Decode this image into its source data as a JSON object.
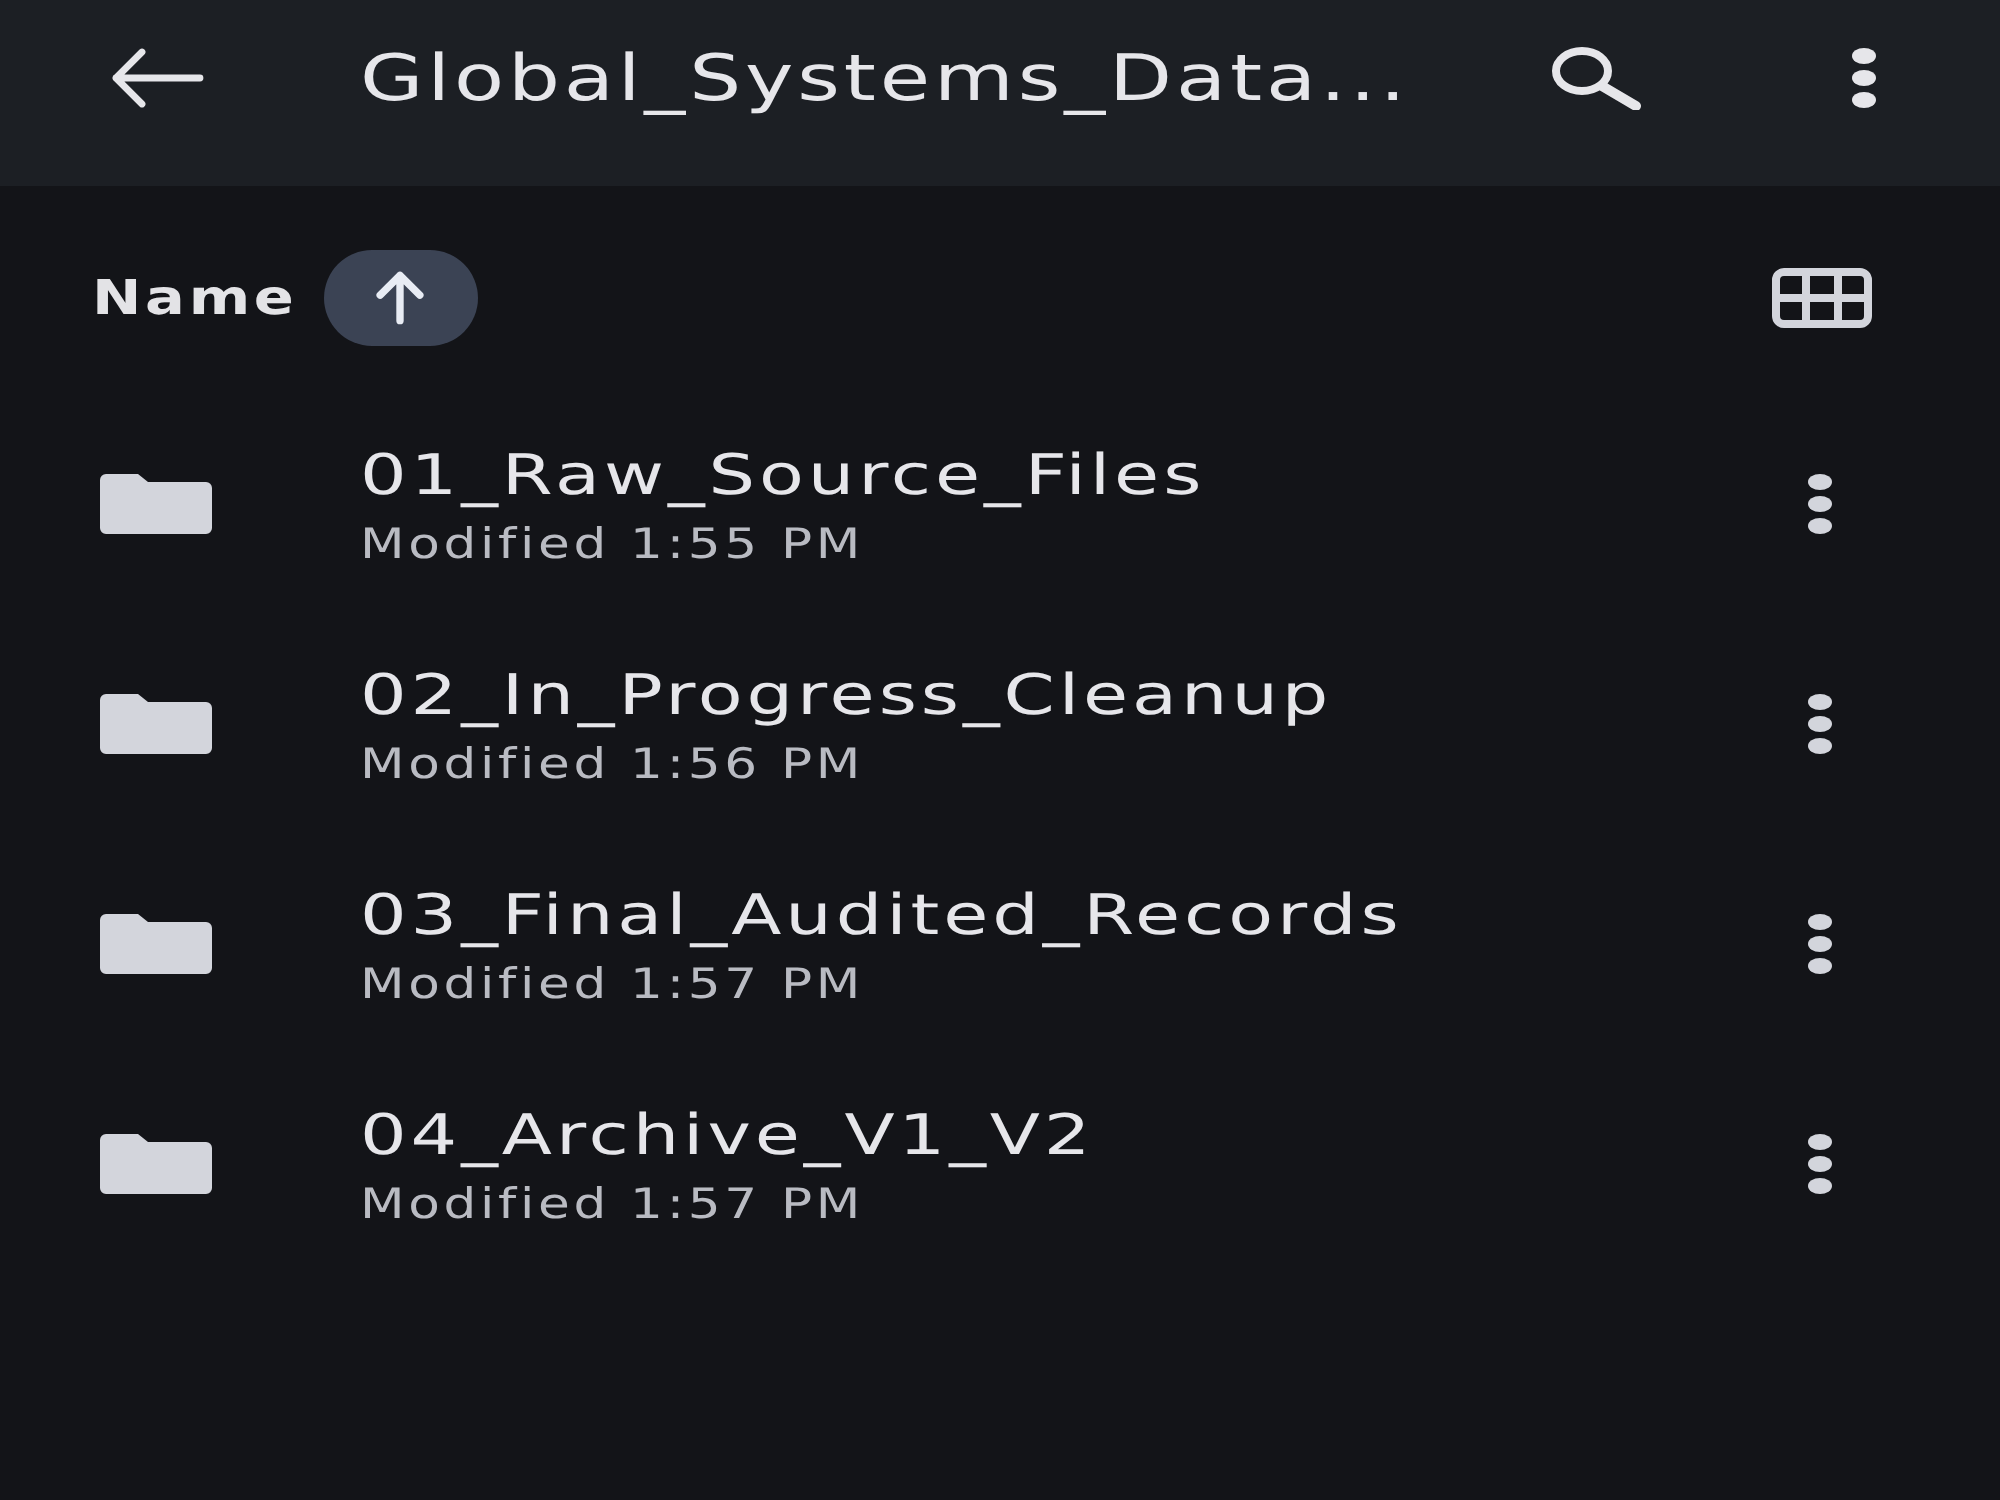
{
  "app_bar": {
    "title": "Global_Systems_Data..."
  },
  "sort": {
    "label": "Name",
    "ascending": true
  },
  "files": [
    {
      "kind": "folder",
      "name": "01_Raw_Source_Files",
      "modified": "Modified 1:55 PM"
    },
    {
      "kind": "folder",
      "name": "02_In_Progress_Cleanup",
      "modified": "Modified 1:56 PM"
    },
    {
      "kind": "folder",
      "name": "03_Final_Audited_Records",
      "modified": "Modified 1:57 PM"
    },
    {
      "kind": "folder",
      "name": "04_Archive_V1_V2",
      "modified": "Modified 1:57 PM"
    }
  ]
}
